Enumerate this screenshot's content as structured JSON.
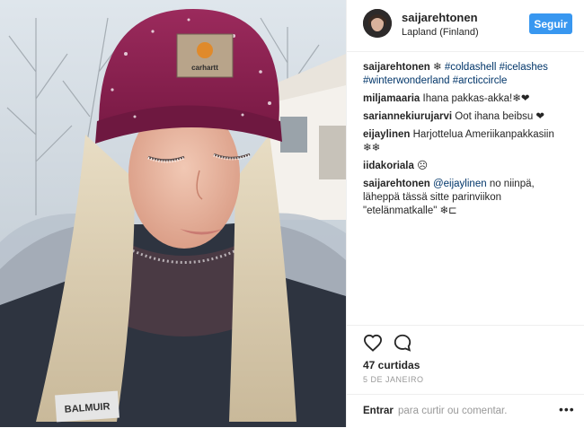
{
  "post": {
    "username": "saijarehtonen",
    "location": "Lapland (Finland)",
    "follow_label": "Seguir",
    "caption": {
      "user": "saijarehtonen",
      "emoji": "❄",
      "tags": [
        "#coldashell",
        "#icelashes",
        "#winterwonderland",
        "#arcticcircle"
      ]
    },
    "comments": [
      {
        "user": "miljamaaria",
        "text": "Ihana pakkas-akka!❄❤"
      },
      {
        "user": "sariannekiurujarvi",
        "text": "Oot ihana beibsu ❤"
      },
      {
        "user": "eijaylinen",
        "text": "Harjottelua Ameriikanpakkasiin ❄❄"
      },
      {
        "user": "iidakoriala",
        "text": "☹"
      },
      {
        "user": "saijarehtonen",
        "mention": "@eijaylinen",
        "text": "no niinpä, läheppä tässä sitte parinviikon \"etelänmatkalle\" ❄⊏"
      }
    ],
    "likes": "47 curtidas",
    "date": "5 DE JANEIRO",
    "login_label": "Entrar",
    "comment_prompt": "para curtir ou comentar.",
    "more_label": "•••",
    "beanie_label": "carhartt"
  },
  "icons": {
    "like": "heart-outline-icon",
    "comment": "speech-bubble-icon",
    "more": "ellipsis-icon"
  },
  "colors": {
    "follow_button": "#3897f0",
    "hashtag": "#003569",
    "beanie": "#8b1e4f",
    "muted_text": "#999999"
  }
}
